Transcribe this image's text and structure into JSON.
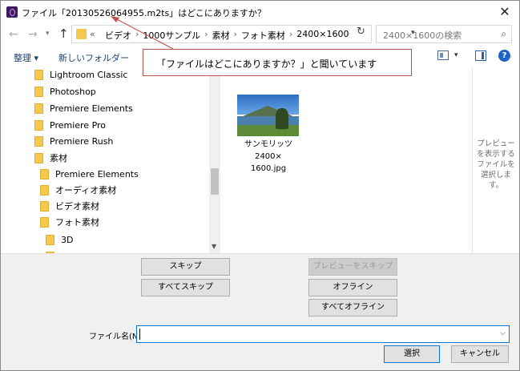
{
  "title": "ファイル「20130526064955.m2ts」はどこにありますか？",
  "address": {
    "chevrons": "«",
    "crumbs": [
      "ビデオ",
      "1000サンプル",
      "素材",
      "フォト素材",
      "2400×1600"
    ],
    "search_placeholder": "2400×1600の検索"
  },
  "toolbar": {
    "organize": "整理 ▾",
    "new_folder": "新しいフォルダー"
  },
  "tree": [
    {
      "label": "Lightroom Classic"
    },
    {
      "label": "Photoshop"
    },
    {
      "label": "Premiere Elements"
    },
    {
      "label": "Premiere Pro"
    },
    {
      "label": "Premiere Rush"
    },
    {
      "label": "素材"
    },
    {
      "label": "Premiere Elements"
    },
    {
      "label": "オーディオ素材"
    },
    {
      "label": "ビデオ素材"
    },
    {
      "label": "フォト素材"
    },
    {
      "label": "3D"
    }
  ],
  "file": {
    "name_line1": "サンモリッツ2400×",
    "name_line2": "1600.jpg"
  },
  "preview_hint": "プレビューを表示するファイルを選択します。",
  "callout": "「ファイルはどこにありますか？」と聞いています",
  "buttons": {
    "skip": "スキップ",
    "skip_all": "すべてスキップ",
    "preview_skip": "プレビューをスキップ",
    "offline": "オフライン",
    "offline_all": "すべてオフライン",
    "select": "選択",
    "cancel": "キャンセル"
  },
  "filename": {
    "label": "ファイル名(N):",
    "value": ""
  },
  "colors": {
    "accent": "#0078d7",
    "callout_border": "#c0504d",
    "folder": "#f5c94e"
  }
}
